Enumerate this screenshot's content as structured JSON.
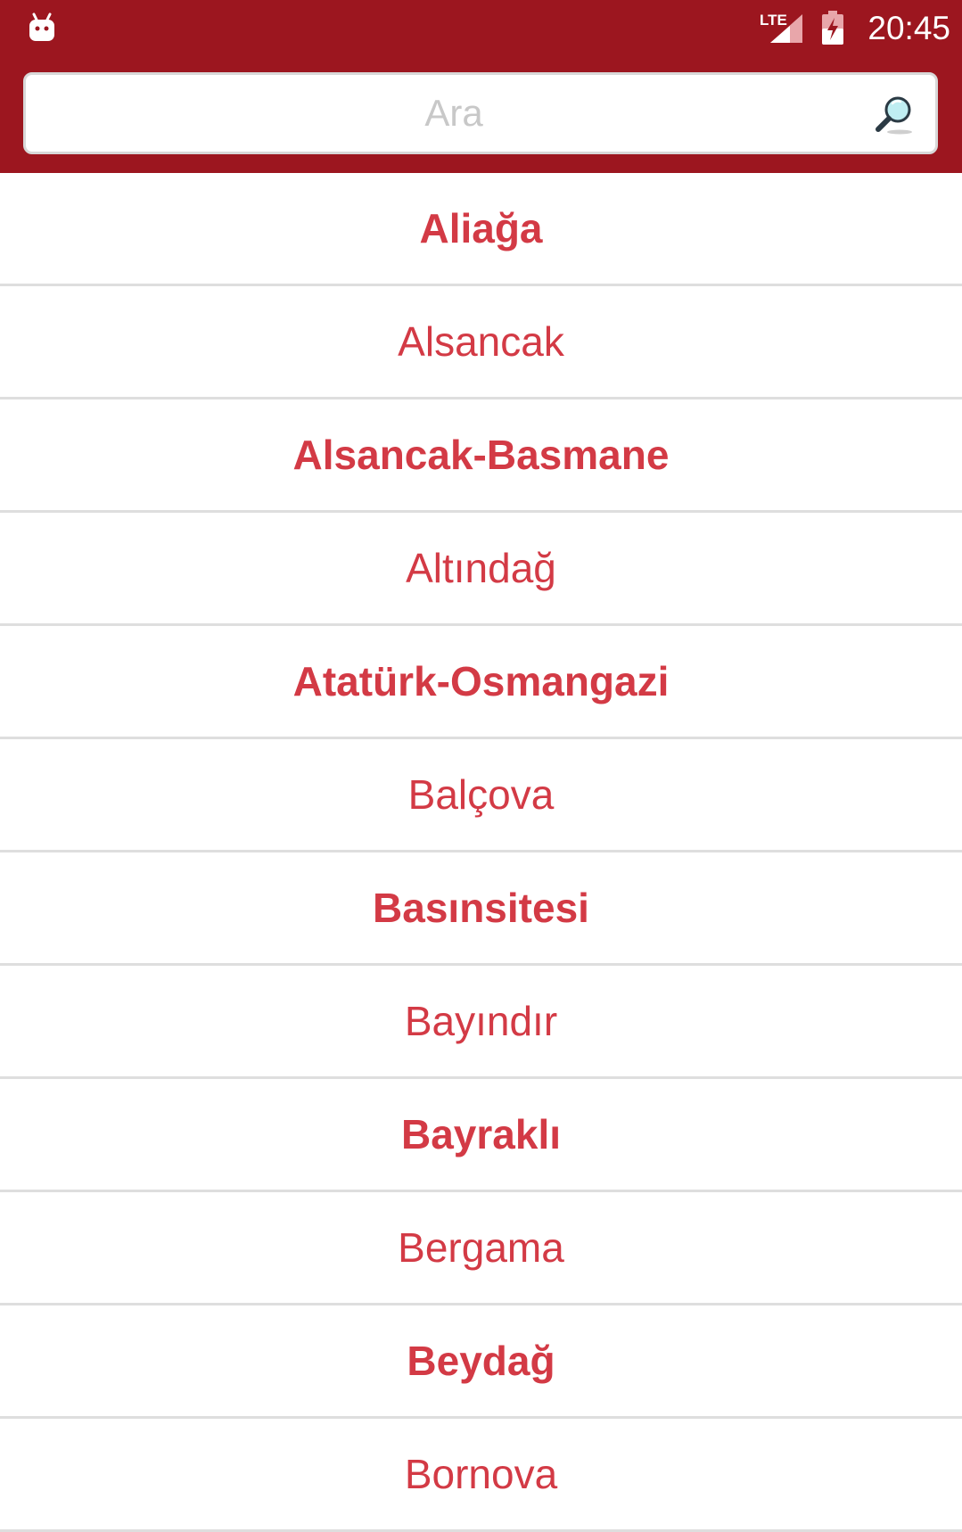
{
  "status_bar": {
    "time": "20:45",
    "network_label": "LTE",
    "background_color": "#9c161f",
    "icons": [
      "app-notification-icon",
      "lte-signal-icon",
      "battery-charging-icon"
    ]
  },
  "search": {
    "placeholder": "Ara",
    "value": "",
    "icon": "magnifier-icon"
  },
  "list": {
    "accent_color": "#d33a45",
    "items": [
      {
        "label": "Aliağa",
        "bold": true
      },
      {
        "label": "Alsancak",
        "bold": false
      },
      {
        "label": "Alsancak-Basmane",
        "bold": true
      },
      {
        "label": "Altındağ",
        "bold": false
      },
      {
        "label": "Atatürk-Osmangazi",
        "bold": true
      },
      {
        "label": "Balçova",
        "bold": false
      },
      {
        "label": "Basınsitesi",
        "bold": true
      },
      {
        "label": "Bayındır",
        "bold": false
      },
      {
        "label": "Bayraklı",
        "bold": true
      },
      {
        "label": "Bergama",
        "bold": false
      },
      {
        "label": "Beydağ",
        "bold": true
      },
      {
        "label": "Bornova",
        "bold": false
      }
    ]
  }
}
